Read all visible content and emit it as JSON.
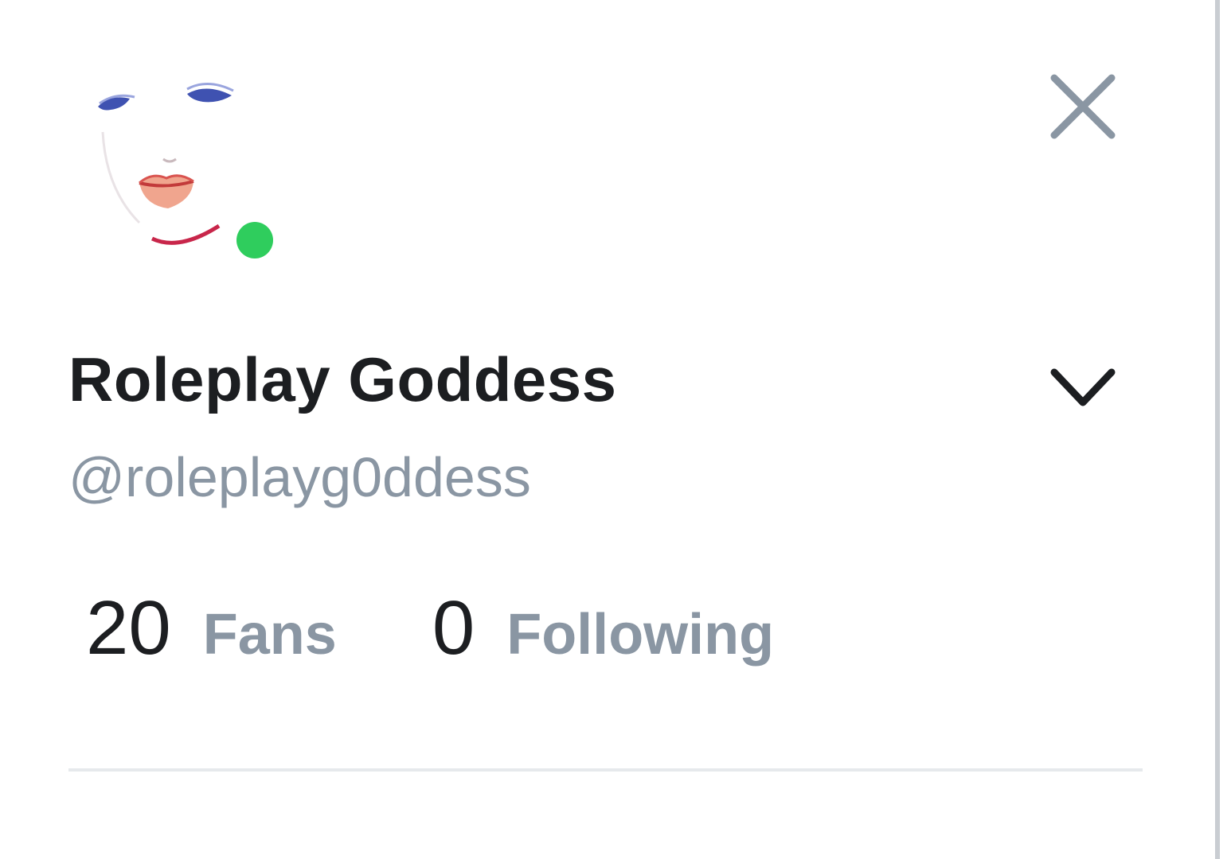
{
  "profile": {
    "display_name": "Roleplay Goddess",
    "handle": "@roleplayg0ddess",
    "online": true,
    "status_color": "#2fcd5d"
  },
  "stats": {
    "fans_count": "20",
    "fans_label": "Fans",
    "following_count": "0",
    "following_label": "Following"
  },
  "icons": {
    "close": "close-icon",
    "expand": "chevron-down-icon"
  },
  "colors": {
    "primary_text": "#1c1e21",
    "secondary_text": "#8a96a3",
    "divider": "#e6e9ec",
    "icon_gray": "#8a96a3",
    "icon_dark": "#1c1e21"
  }
}
